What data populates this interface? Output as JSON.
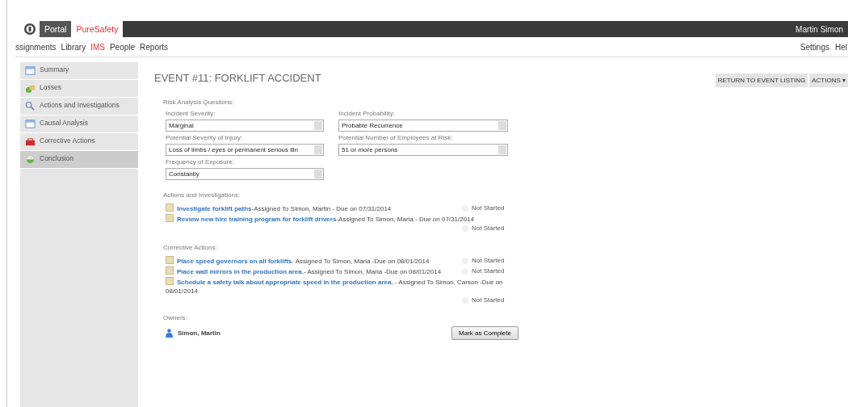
{
  "top_bar": {
    "tabs": [
      {
        "label": "Portal",
        "selected": false
      },
      {
        "label": "PureSafety",
        "selected": true
      }
    ],
    "user": "Martin Simon"
  },
  "nav": {
    "items": [
      {
        "label": "ssignments",
        "selected": false
      },
      {
        "label": "Library",
        "selected": false
      },
      {
        "label": "IMS",
        "selected": true
      },
      {
        "label": "People",
        "selected": false
      },
      {
        "label": "Reports",
        "selected": false
      }
    ],
    "right": [
      "Settings",
      "Hel"
    ]
  },
  "sidebar": {
    "items": [
      {
        "label": "Summary",
        "selected": false
      },
      {
        "label": "Losses",
        "selected": false
      },
      {
        "label": "Actions and Investigations",
        "selected": false
      },
      {
        "label": "Causal Analysis",
        "selected": false
      },
      {
        "label": "Corrective Actions",
        "selected": false
      },
      {
        "label": "Conclusion",
        "selected": true
      }
    ]
  },
  "title": "EVENT #11: FORKLIFT ACCIDENT",
  "header_buttons": [
    "RETURN TO EVENT LISTING",
    "ACTIONS ▾"
  ],
  "risk": {
    "heading": "Risk Analysis Questions:",
    "fields": [
      {
        "label": "Incident Severity:",
        "value": "Marginal"
      },
      {
        "label": "Incident Probability:",
        "value": "Probable Recurrence"
      },
      {
        "label": "Potential Severity of Injury:",
        "value": "Loss of limbs / eyes or permanent serious illn"
      },
      {
        "label": "Potential Number of Employees at Risk:",
        "value": "51 or more persons"
      },
      {
        "label": "Frequency of Exposure:",
        "value": "Constantly"
      }
    ]
  },
  "sections": [
    {
      "heading": "Actions and Investigations:",
      "items": [
        {
          "link": "Investigate forklift paths",
          "detail": "-Assigned To Simon, Martin - Due on 07/31/2014",
          "status": "Not Started"
        },
        {
          "link": "Review new hire training program for forklift drivers",
          "detail": "-Assigned To Simon, Maria - Due on 07/31/2014",
          "status": "Not Started"
        }
      ]
    },
    {
      "heading": "Corrective Actions:",
      "items": [
        {
          "link": "Place speed governors on all forklifts",
          "detail": "- Assigned To Simon, Maria -Due on 08/01/2014",
          "status": "Not Started"
        },
        {
          "link": "Place wall mirrors in the production area.",
          "detail": "- Assigned To Simon, Maria -Due on 08/01/2014",
          "status": "Not Started"
        },
        {
          "link": "Schedule a safety talk about appropriate speed in the production area.",
          "detail": " - Assigned To Simon, Carson -Due on 08/01/2014",
          "status": "Not Started"
        }
      ]
    }
  ],
  "owners": {
    "heading": "Owners:",
    "names": [
      "Simon, Martin"
    ]
  },
  "complete_button": "Mark as Complete"
}
